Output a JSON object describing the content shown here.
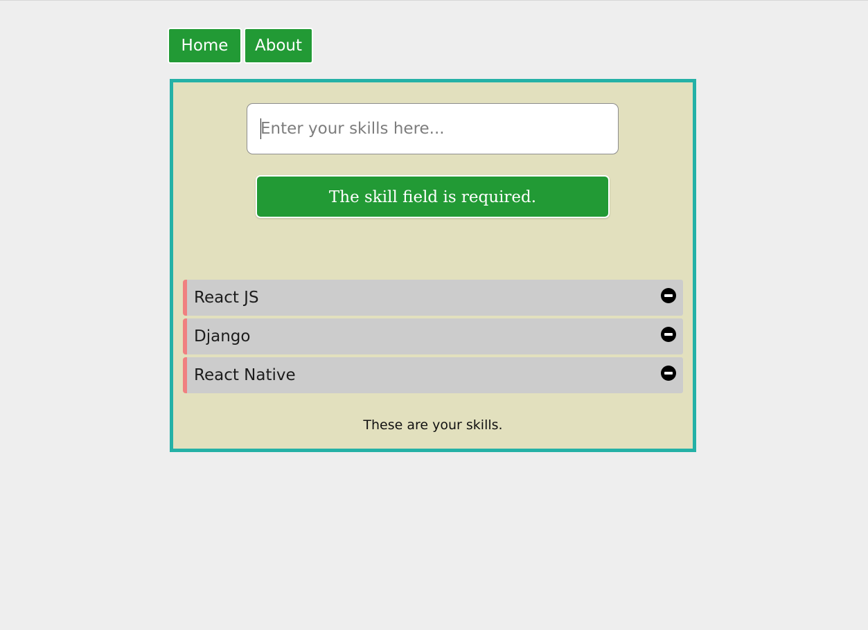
{
  "nav": {
    "home_label": "Home",
    "about_label": "About"
  },
  "form": {
    "input_value": "",
    "input_placeholder": "Enter your skills here...",
    "validation_message": "The skill field is required."
  },
  "skills": {
    "items": [
      {
        "label": "React JS",
        "remove_icon": "minus-circle-icon"
      },
      {
        "label": "Django",
        "remove_icon": "minus-circle-icon"
      },
      {
        "label": "React Native",
        "remove_icon": "minus-circle-icon"
      }
    ],
    "footer_text": "These are your skills."
  },
  "colors": {
    "page_background": "#eeeeee",
    "accent_green": "#229a35",
    "panel_background": "#e2e0be",
    "panel_border": "#24b1a6",
    "item_background": "#cccccc",
    "item_accent": "#f08080"
  }
}
